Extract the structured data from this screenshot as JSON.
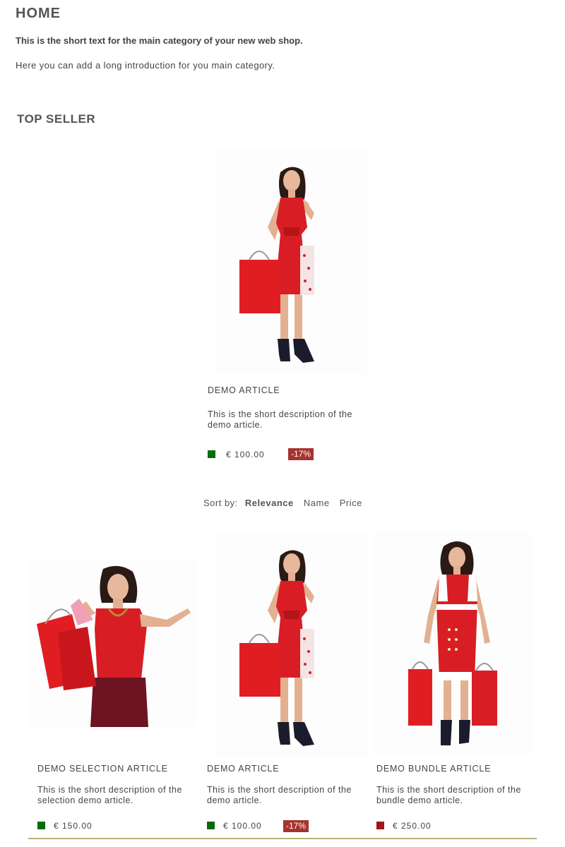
{
  "page": {
    "title": "HOME",
    "short_text": "This is the short text for the main category of your new web shop.",
    "long_text": "Here you can add a long introduction for you main category."
  },
  "top_seller": {
    "title": "TOP SELLER",
    "product": {
      "image": "woman-red-wrap-dress-with-bags",
      "name": "DEMO ARTICLE",
      "description": "This is the short description of the demo article.",
      "stock_color": "#0b6b0b",
      "price": "€ 100.00",
      "badge": "-17%"
    }
  },
  "sort": {
    "label": "Sort by:",
    "options": [
      "Relevance",
      "Name",
      "Price"
    ],
    "active": "Relevance"
  },
  "products": [
    {
      "image": "woman-red-top-with-bags",
      "name": "DEMO SELECTION ARTICLE",
      "description": "This is the short description of the selection demo article.",
      "stock_color": "#0b6b0b",
      "price": "€ 150.00",
      "badge": ""
    },
    {
      "image": "woman-red-wrap-dress-with-bags",
      "name": "DEMO ARTICLE",
      "description": "This is the short description of the demo article.",
      "stock_color": "#0b6b0b",
      "price": "€ 100.00",
      "badge": "-17%"
    },
    {
      "image": "woman-red-white-dress-with-bags",
      "name": "DEMO BUNDLE ARTICLE",
      "description": "This is the short description of the bundle demo article.",
      "stock_color": "#a31515",
      "price": "€ 250.00",
      "badge": ""
    }
  ],
  "colors": {
    "badge_bg": "#a6332e",
    "footer_line": "#b8b27a",
    "dress_red": "#d81e24"
  }
}
